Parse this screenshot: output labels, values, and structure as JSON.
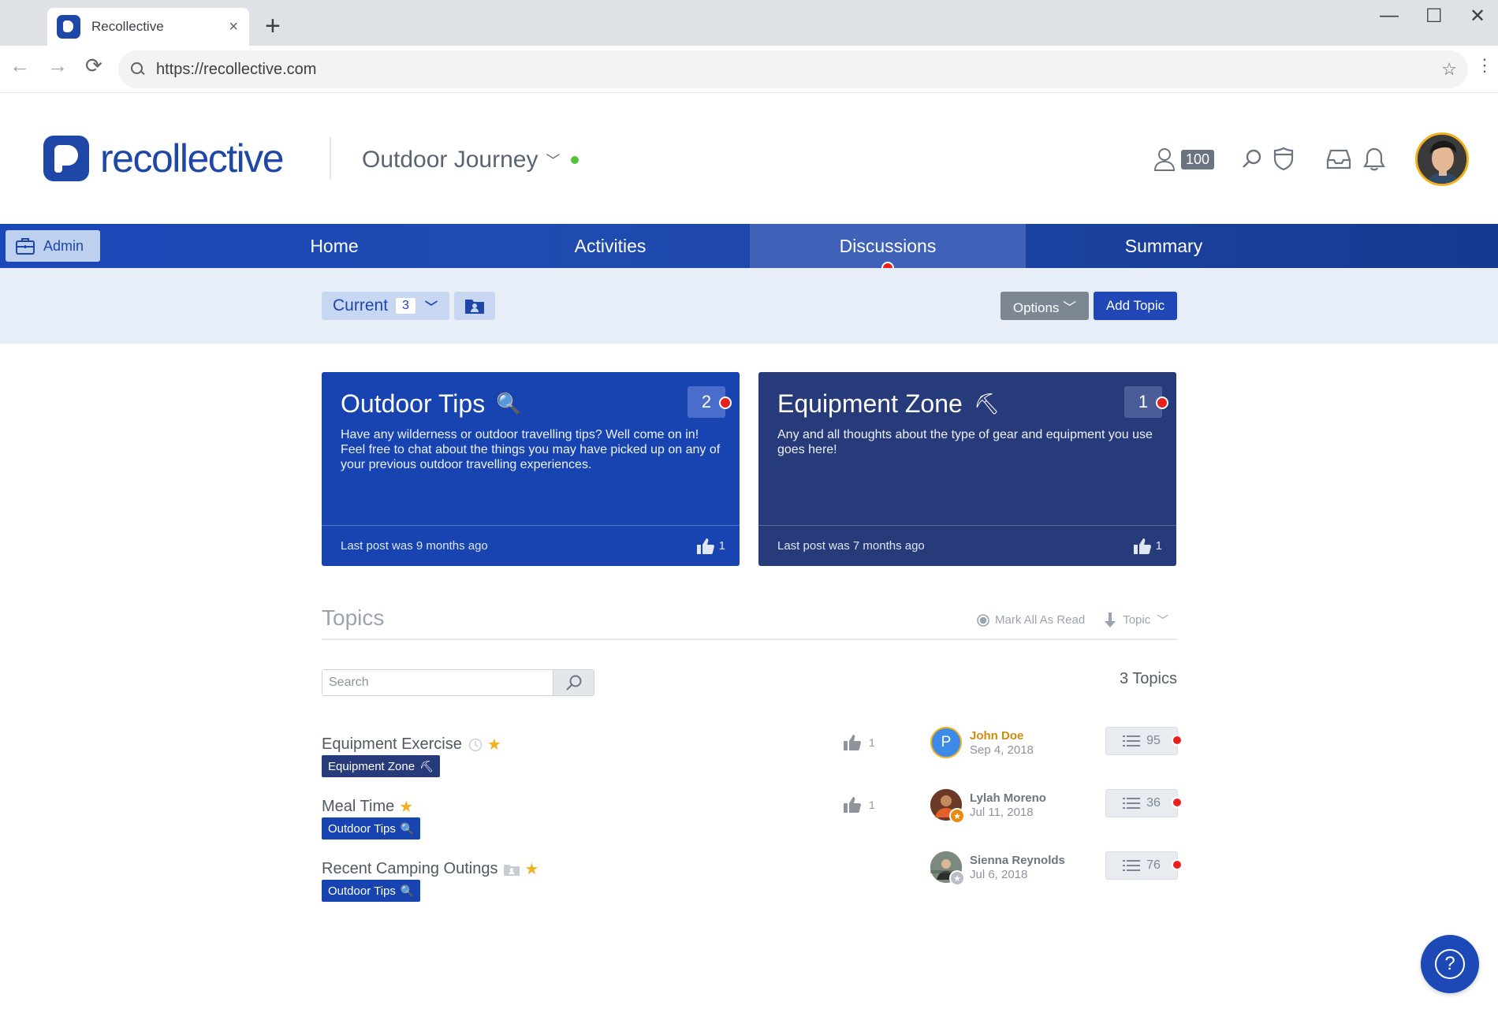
{
  "browser": {
    "tab_title": "Recollective",
    "tab_close": "×",
    "new_tab": "+",
    "url": "https://recollective.com",
    "minimize": "—",
    "maximize": "☐",
    "close": "✕",
    "back": "←",
    "forward": "→",
    "reload": "⟳",
    "bookmark": "☆",
    "menu": "⋮"
  },
  "header": {
    "logo_text": "recollective",
    "community_name": "Outdoor Journey",
    "community_chevron": "﹀",
    "participants_count": "100",
    "accent_color": "#1f47a8",
    "online_color": "#57c23a"
  },
  "nav": {
    "admin_label": "Admin",
    "items": [
      {
        "label": "Home"
      },
      {
        "label": "Activities"
      },
      {
        "label": "Discussions"
      },
      {
        "label": "Summary"
      }
    ],
    "active_index": 2
  },
  "filters": {
    "current_label": "Current",
    "current_count": "3",
    "current_chevron": "﹀",
    "options_label": "Options ﹀",
    "add_topic_label": "Add Topic"
  },
  "cards": [
    {
      "title": "Outdoor Tips",
      "emoji": "🔍",
      "description": "Have any wilderness or outdoor travelling tips? Well come on in! Feel free to chat about the things you may have picked up on any of your previous outdoor travelling experiences.",
      "badge": "2",
      "last_post": "Last post was 9 months ago",
      "likes": "1",
      "color": "#1744b0"
    },
    {
      "title": "Equipment Zone",
      "emoji": "⛏",
      "description": "Any and all thoughts about the type of gear and equipment you use goes here!",
      "badge": "1",
      "last_post": "Last post was 7 months ago",
      "likes": "1",
      "color": "#273a7a"
    }
  ],
  "topics": {
    "title": "Topics",
    "mark_all_read": "Mark All As Read",
    "sort_label": "Topic",
    "sort_chevron": "﹀",
    "search_placeholder": "Search",
    "count_label": "3 Topics",
    "rows": [
      {
        "name": "Equipment Exercise",
        "star": "★",
        "chip": "Equipment Zone",
        "chip_emoji": "⛏",
        "likes": "1",
        "author": "John Doe",
        "avatar_initial": "P",
        "date": "Sep 4, 2018",
        "replies": "95"
      },
      {
        "name": "Meal Time",
        "star": "★",
        "chip": "Outdoor Tips",
        "chip_emoji": "🔍",
        "likes": "1",
        "author": "Lylah Moreno",
        "date": "Jul 11, 2018",
        "replies": "36"
      },
      {
        "name": "Recent Camping Outings",
        "star": "★",
        "chip": "Outdoor Tips",
        "chip_emoji": "🔍",
        "author": "Sienna Reynolds",
        "date": "Jul 6, 2018",
        "replies": "76"
      }
    ]
  },
  "help": {
    "label": "?"
  }
}
